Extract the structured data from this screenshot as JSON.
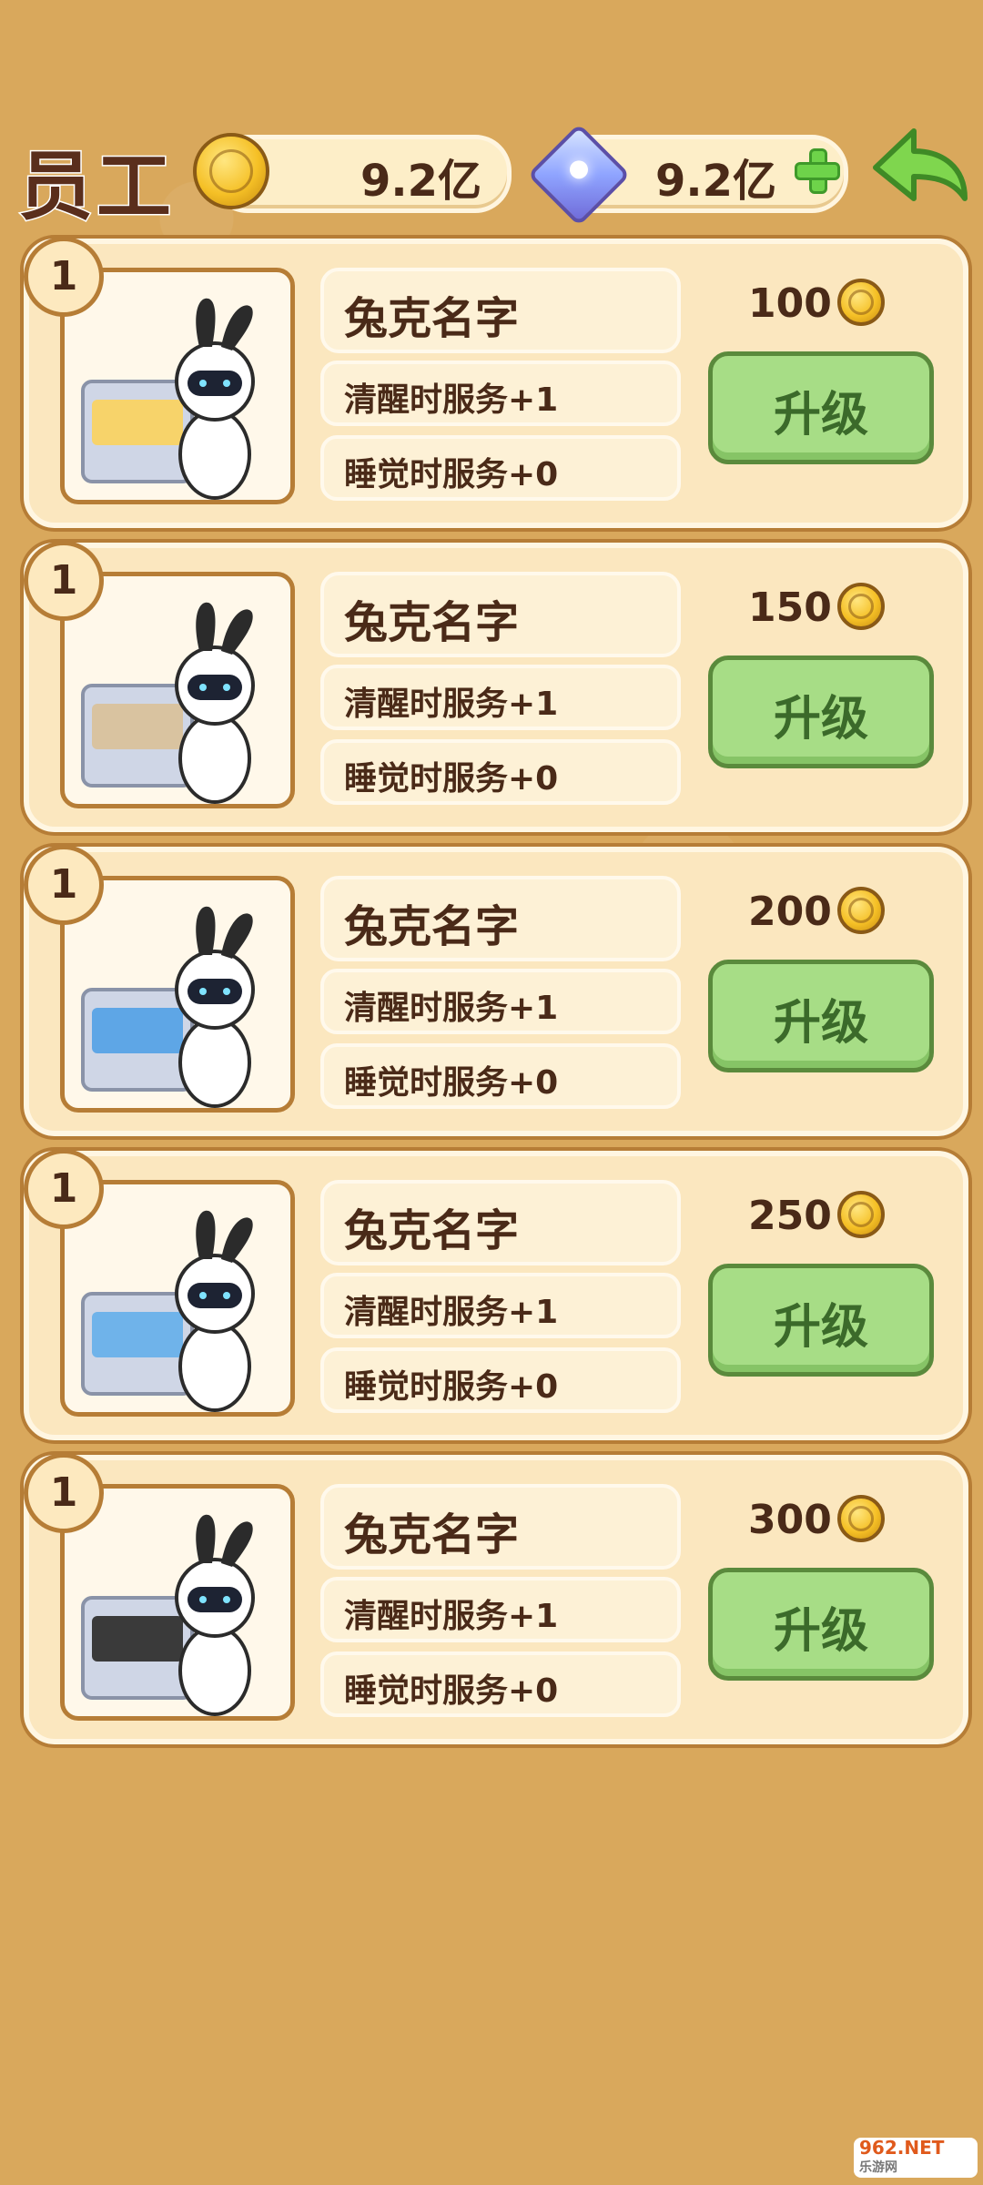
{
  "header": {
    "title": "员工",
    "coins": "9.2亿",
    "gems": "9.2亿",
    "coin_icon": "gold-coin-icon",
    "gem_icon": "diamond-gem-icon",
    "add_icon": "plus-icon",
    "back_icon": "back-arrow-icon"
  },
  "staff": [
    {
      "level": "1",
      "name": "兔克名字",
      "awake": "清醒时服务+1",
      "asleep": "睡觉时服务+0",
      "cost": "100",
      "button": "升级",
      "scene": "ice-cream-station"
    },
    {
      "level": "1",
      "name": "兔克名字",
      "awake": "清醒时服务+1",
      "asleep": "睡觉时服务+0",
      "cost": "150",
      "button": "升级",
      "scene": "chef-grill-station"
    },
    {
      "level": "1",
      "name": "兔克名字",
      "awake": "清醒时服务+1",
      "asleep": "睡觉时服务+0",
      "cost": "200",
      "button": "升级",
      "scene": "sink-washing"
    },
    {
      "level": "1",
      "name": "兔克名字",
      "awake": "清醒时服务+1",
      "asleep": "睡觉时服务+0",
      "cost": "250",
      "button": "升级",
      "scene": "dish-washing"
    },
    {
      "level": "1",
      "name": "兔克名字",
      "awake": "清醒时服务+1",
      "asleep": "睡觉时服务+0",
      "cost": "300",
      "button": "升级",
      "scene": "drink-dispenser"
    }
  ],
  "watermark": {
    "line1": "962.NET",
    "line2": "乐游网"
  },
  "colors": {
    "background": "#d9a85c",
    "card": "#fbe7bf",
    "border": "#b67d36",
    "upgrade": "#a7dd86",
    "text": "#4a2a18"
  }
}
